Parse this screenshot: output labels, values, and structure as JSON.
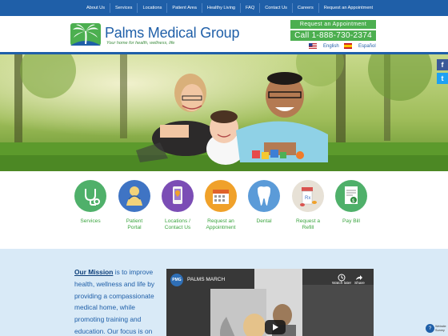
{
  "nav": {
    "items": [
      "About Us",
      "Services",
      "Locations",
      "Patient Area",
      "Healthy Living",
      "FAQ",
      "Contact Us",
      "Careers",
      "Request an Appointment"
    ]
  },
  "header": {
    "logo_title": "Palms Medical Group",
    "logo_tagline": "Your home for health, wellness, life",
    "request_button": "Request an Appointment",
    "call_button": "Call 1-888-730-2374",
    "lang_english": "English",
    "lang_spanish": "Español"
  },
  "social": {
    "facebook": "f",
    "twitter": "t"
  },
  "services": [
    {
      "label": "Services",
      "icon": "stethoscope-icon",
      "color": "#4fb06a"
    },
    {
      "label": "Patient Portal",
      "icon": "patient-portal-icon",
      "color": "#3f74c4"
    },
    {
      "label": "Locations / Contact Us",
      "icon": "phone-location-icon",
      "color": "#7b4db5"
    },
    {
      "label": "Request an Appointment",
      "icon": "calendar-icon",
      "color": "#f0a12a"
    },
    {
      "label": "Dental",
      "icon": "tooth-icon",
      "color": "#5b9bd8"
    },
    {
      "label": "Request a Refill",
      "icon": "prescription-bottle-icon",
      "color": "#cfc6b8"
    },
    {
      "label": "Pay Bill",
      "icon": "bill-icon",
      "color": "#4fb06a"
    }
  ],
  "mission": {
    "link": "Our Mission",
    "text": " is to improve health, wellness and life by providing a compassionate medical home, while promoting training and education. Our focus is on"
  },
  "video": {
    "channel_badge": "PMG",
    "title": "PALMS MARCH",
    "watch_later": "Watch later",
    "share": "Share"
  },
  "badge": {
    "line1": "Website",
    "line2": "Survey"
  },
  "colors": {
    "brand_blue": "#1f5fa8",
    "brand_green": "#4caf50",
    "mission_bg": "#d9eaf7"
  }
}
